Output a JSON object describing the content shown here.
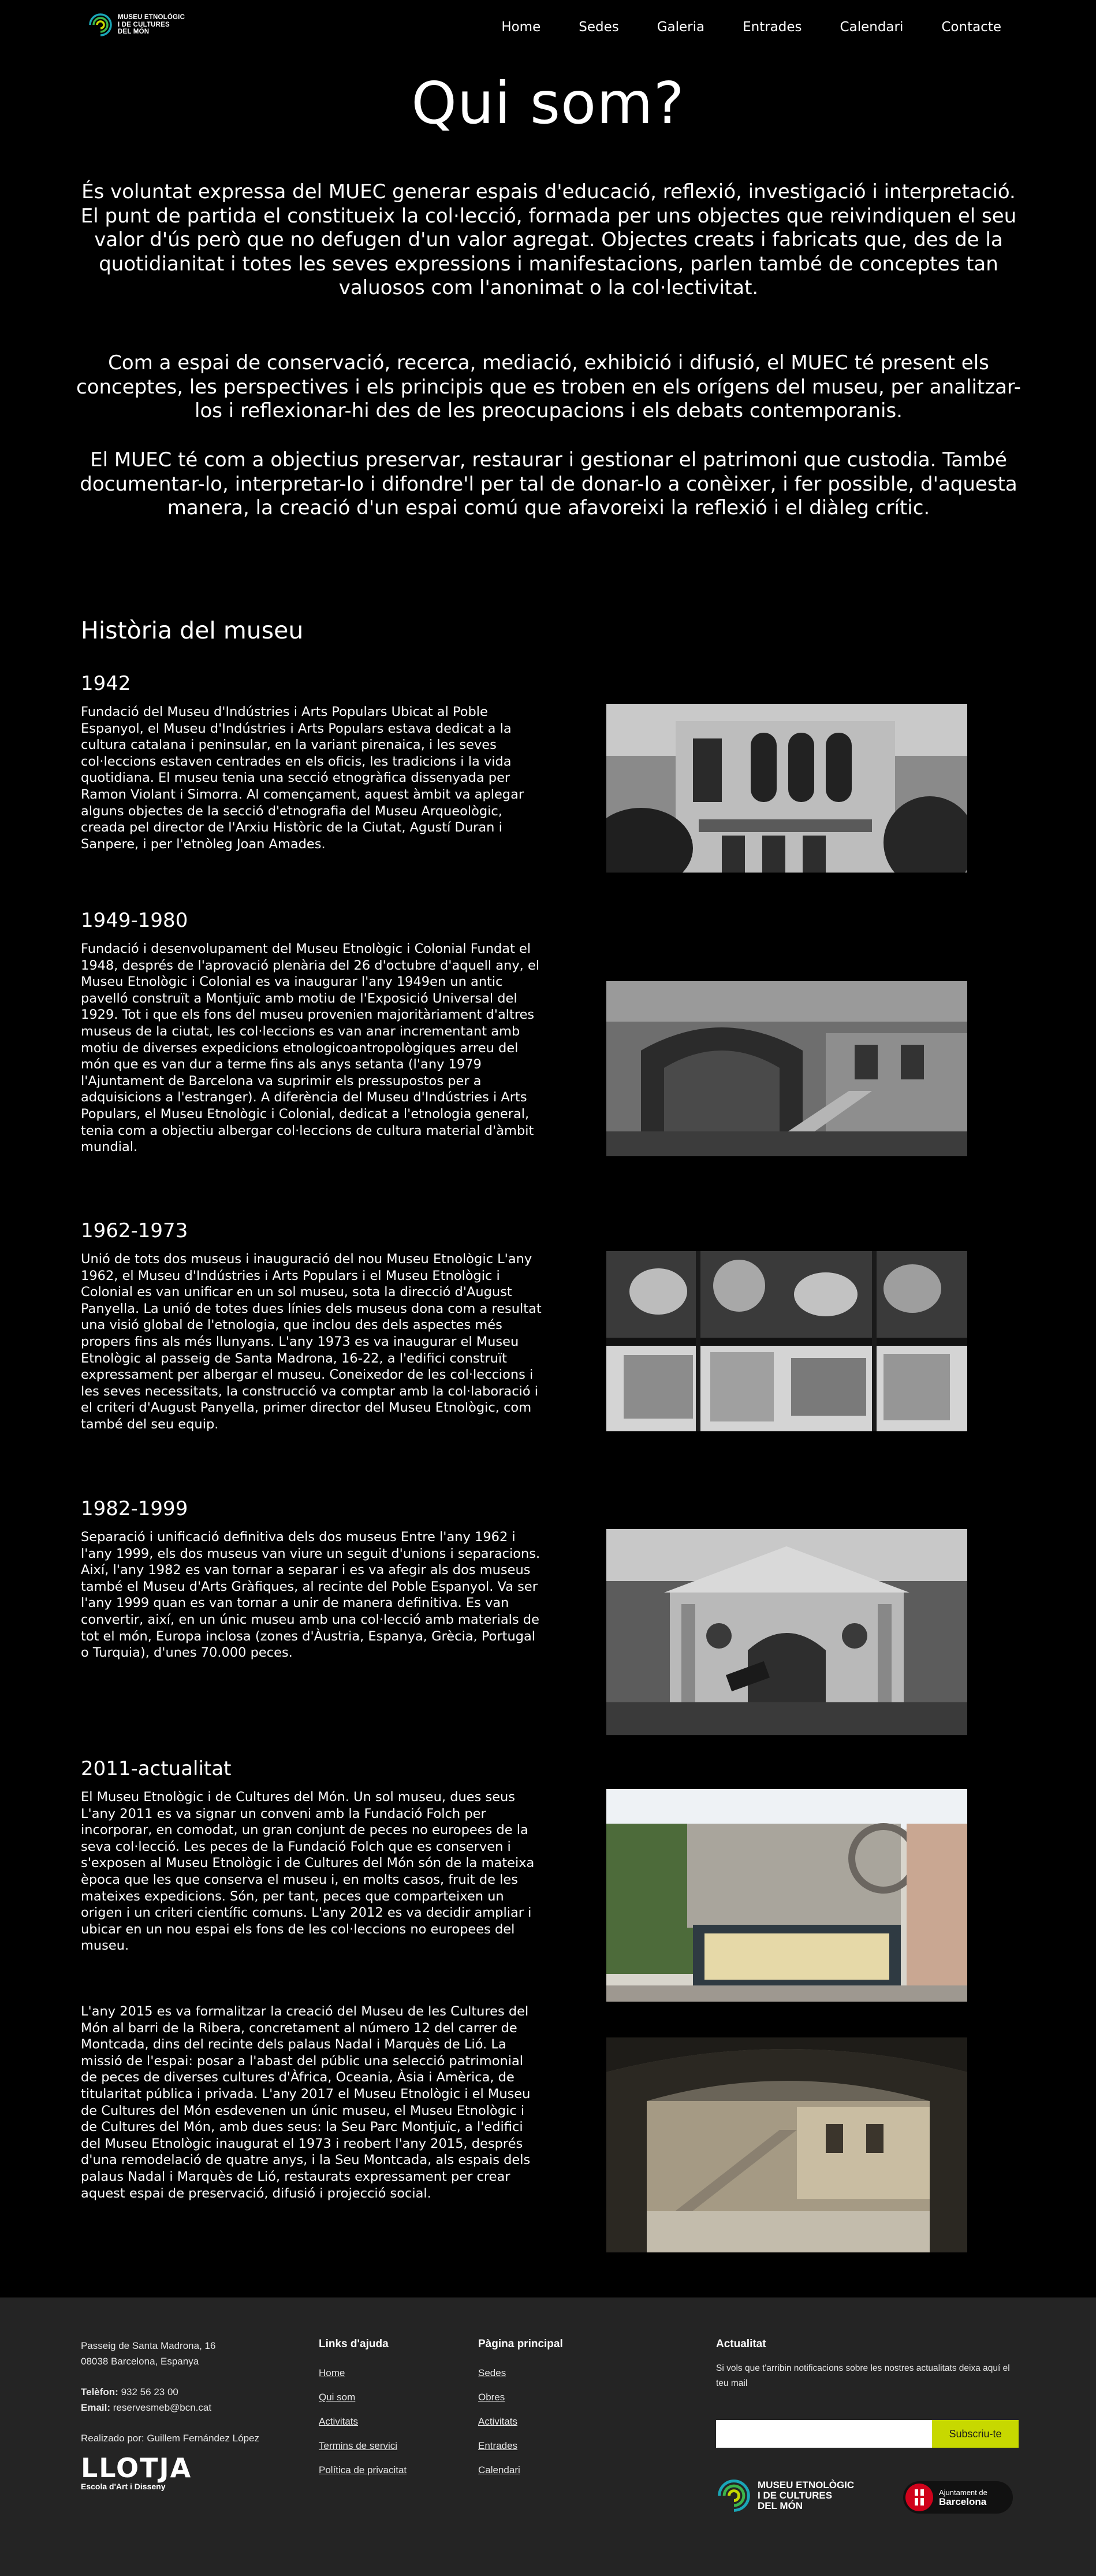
{
  "header": {
    "logo_lines": [
      "MUSEU ETNOLÒGIC",
      "I DE CULTURES",
      "DEL MÓN"
    ],
    "nav": [
      "Home",
      "Sedes",
      "Galeria",
      "Entrades",
      "Calendari",
      "Contacte"
    ]
  },
  "intro": {
    "title": "Qui som?",
    "paragraphs": [
      "És voluntat expressa del MUEC generar espais d'educació, reflexió, investigació i interpretació. El punt de partida el constitueix la col·lecció, formada per uns objectes que reivindiquen el seu valor d'ús però que no defugen d'un valor agregat. Objectes creats i fabricats que, des de la quotidianitat i totes les seves expressions i manifestacions, parlen també de conceptes tan valuosos com l'anonimat o la col·lectivitat.",
      "Com a espai de conservació, recerca, mediació, exhibició i difusió, el MUEC té present els conceptes, les perspectives i els principis que es troben en els orígens del museu, per analitzar-los i reflexionar-hi des de les preocupacions i els debats contemporanis.",
      "El MUEC té com a objectius preservar, restaurar i gestionar el patrimoni que custodia. També documentar-lo, interpretar-lo i difondre'l per tal de donar-lo a conèixer, i fer possible, d'aquesta manera, la creació d'un espai comú que afavoreixi la reflexió i el diàleg crític."
    ]
  },
  "history": {
    "heading": "Història del museu",
    "eras": [
      {
        "title": "1942",
        "text": "Fundació del Museu d'Indústries i Arts Populars Ubicat al Poble Espanyol, el Museu d'Indústries i Arts Populars estava dedicat a la cultura catalana i peninsular, en la variant pirenaica, i les seves col·leccions estaven centrades en els oficis, les tradicions i la vida quotidiana. El museu tenia una secció etnogràfica dissenyada per Ramon Violant i Simorra. Al començament, aquest àmbit va aplegar alguns objectes de la secció d'etnografia del Museu Arqueològic, creada pel director de l'Arxiu Històric de la Ciutat, Agustí Duran i Sanpere, i per l'etnòleg Joan Amades."
      },
      {
        "title": "1949-1980",
        "text": "Fundació i desenvolupament del Museu Etnològic i Colonial Fundat el 1948, després de l'aprovació plenària del 26 d'octubre d'aquell any, el Museu Etnològic i Colonial es va inaugurar l'any 1949en un antic pavelló construït a Montjuïc amb motiu de l'Exposició Universal del 1929. Tot i que els fons del museu provenien majoritàriament d'altres museus de la ciutat, les col·leccions es van anar incrementant amb motiu de diverses expedicions etnologicoantropològiques arreu del món que es van dur a terme fins als anys setanta (l'any 1979 l'Ajuntament de Barcelona va suprimir els pressupostos per a adquisicions a l'estranger). A diferència del Museu d'Indústries i Arts Populars, el Museu Etnològic i Colonial, dedicat a l'etnologia general, tenia com a objectiu albergar col·leccions de cultura material d'àmbit mundial."
      },
      {
        "title": "1962-1973",
        "text": "Unió de tots dos museus i inauguració del nou Museu Etnològic L'any 1962, el Museu d'Indústries i Arts Populars i el Museu Etnològic i Colonial es van unificar en un sol museu, sota la direcció d'August Panyella. La unió de totes dues línies dels museus dona com a resultat una visió global de l'etnologia, que inclou des dels aspectes més propers fins als més llunyans. L'any 1973 es va inaugurar el Museu Etnològic al passeig de Santa Madrona, 16-22, a l'edifici construït expressament per albergar el museu. Coneixedor de les col·leccions i les seves necessitats, la construcció va comptar amb la col·laboració i el criteri d'August Panyella, primer director del Museu Etnològic, com també del seu equip."
      },
      {
        "title": "1982-1999",
        "text": "Separació i unificació definitiva dels dos museus Entre l'any 1962 i l'any 1999, els dos museus van viure un seguit d'unions i separacions. Així, l'any 1982 es van tornar a separar i es va afegir als dos museus també el Museu d'Arts Gràfiques, al recinte del Poble Espanyol. Va ser l'any 1999 quan es van tornar a unir de manera definitiva. Es van convertir, així, en un únic museu amb una col·lecció amb materials de tot el món, Europa inclosa (zones d'Àustria, Espanya, Grècia, Portugal o Turquia), d'unes 70.000 peces."
      },
      {
        "title": "2011-actualitat",
        "text": "El Museu Etnològic i de Cultures del Món. Un sol museu, dues seus L'any 2011 es va signar un conveni amb la Fundació Folch per incorporar, en comodat, un gran conjunt de peces no europees de la seva col·lecció. Les peces de la Fundació Folch que es conserven i s'exposen al Museu Etnològic i de Cultures del Món són de la mateixa època que les que conserva el museu i, en molts casos, fruit de les mateixes expedicions. Són, per tant, peces que comparteixen un origen i un criteri científic comuns. L'any 2012 es va decidir ampliar i ubicar en un nou espai els fons de les col·leccions no europees del museu.",
        "text2": "L'any 2015 es va formalitzar la creació del Museu de les Cultures del Món al barri de la Ribera, concretament al número 12 del carrer de Montcada, dins del recinte dels palaus Nadal i Marquès de Lió. La missió de l'espai: posar a l'abast del públic una selecció patrimonial de peces de diverses cultures d'Àfrica, Oceania, Àsia i Amèrica, de titularitat pública i privada. L'any 2017 el Museu Etnològic i el Museu de Cultures del Món esdevenen un únic museu, el Museu Etnològic i de Cultures del Món, amb dues seus: la Seu Parc Montjuïc, a l'edifici del Museu Etnològic inaugurat el 1973 i reobert l'any 2015, després d'una remodelació de quatre anys, i la Seu Montcada, als espais dels palaus Nadal i Marquès de Lió, restaurats expressament per crear aquest espai de preservació, difusió i projecció social."
      }
    ]
  },
  "footer": {
    "address": [
      "Passeig de Santa Madrona, 16",
      "08038 Barcelona, Espanya"
    ],
    "phone_label": "Telèfon:",
    "phone": "932 56 23 00",
    "email_label": "Email:",
    "email": "reservesmeb@bcn.cat",
    "credit": "Realizado por: Guillem Fernández López",
    "school_logo": "LLOTJA",
    "school_sub": "Escola d'Art i Disseny",
    "help_heading": "Links d'ajuda",
    "help_links": [
      "Home",
      "Qui som",
      "Activitats",
      "Termins de servici",
      "Política de privacitat"
    ],
    "main_heading": "Pàgina principal",
    "main_links": [
      "Sedes",
      "Obres",
      "Activitats",
      "Entrades",
      "Calendari"
    ],
    "news_heading": "Actualitat",
    "news_text": "Si vols que t'arribin notificacions sobre les nostres actualitats deixa aquí el teu mail",
    "subscribe_label": "Subscriu-te",
    "museum_logo_lines": [
      "MUSEU ETNOLÒGIC",
      "I DE CULTURES",
      "DEL MÓN"
    ],
    "city_logo_lines": [
      "Ajuntament de",
      "Barcelona"
    ]
  },
  "colors": {
    "background": "#000000",
    "footer": "#242424",
    "accent": "#c7d800"
  }
}
